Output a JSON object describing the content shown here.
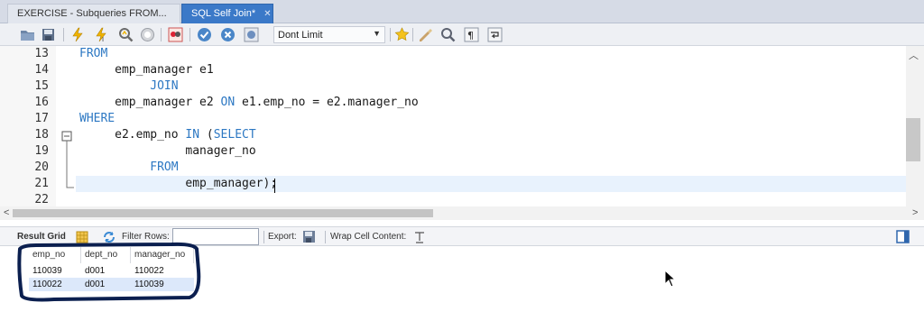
{
  "tabs": [
    {
      "label": "EXERCISE - Subqueries FROM...",
      "active": false
    },
    {
      "label": "SQL Self Join*",
      "active": true
    }
  ],
  "toolbar": {
    "limit_label": "Dont Limit",
    "icons": [
      "open-folder-icon",
      "save-icon",
      "execute-icon",
      "execute-selection-icon",
      "explain-icon",
      "stop-icon",
      "toggle-error-icon",
      "commit-icon",
      "rollback-icon",
      "autocommit-icon",
      "bookmark-icon",
      "beautify-icon",
      "find-icon",
      "invisible-chars-icon",
      "wrap-icon"
    ]
  },
  "editor": {
    "lines": [
      {
        "num": "13",
        "parts": [
          {
            "t": "FROM",
            "k": true
          }
        ]
      },
      {
        "num": "14",
        "parts": [
          {
            "t": "     emp_manager e1",
            "k": false
          }
        ]
      },
      {
        "num": "15",
        "parts": [
          {
            "t": "          ",
            "k": false
          },
          {
            "t": "JOIN",
            "k": true
          }
        ]
      },
      {
        "num": "16",
        "parts": [
          {
            "t": "     emp_manager e2 ",
            "k": false
          },
          {
            "t": "ON",
            "k": true
          },
          {
            "t": " e1.emp_no = e2.manager_no",
            "k": false
          }
        ]
      },
      {
        "num": "17",
        "parts": [
          {
            "t": "WHERE",
            "k": true
          }
        ]
      },
      {
        "num": "18",
        "parts": [
          {
            "t": "     e2.emp_no ",
            "k": false
          },
          {
            "t": "IN",
            "k": true
          },
          {
            "t": " (",
            "k": false
          },
          {
            "t": "SELECT",
            "k": true
          }
        ]
      },
      {
        "num": "19",
        "parts": [
          {
            "t": "               manager_no",
            "k": false
          }
        ]
      },
      {
        "num": "20",
        "parts": [
          {
            "t": "          ",
            "k": false
          },
          {
            "t": "FROM",
            "k": true
          }
        ]
      },
      {
        "num": "21",
        "parts": [
          {
            "t": "               emp_manager);",
            "k": false
          }
        ]
      },
      {
        "num": "22",
        "parts": []
      }
    ]
  },
  "result_bar": {
    "result_grid": "Result Grid",
    "filter_rows": "Filter Rows:",
    "filter_value": "",
    "export": "Export:",
    "wrap_cell": "Wrap Cell Content:"
  },
  "grid": {
    "columns": [
      "emp_no",
      "dept_no",
      "manager_no"
    ],
    "rows": [
      [
        "110039",
        "d001",
        "110022"
      ],
      [
        "110022",
        "d001",
        "110039"
      ]
    ]
  },
  "colors": {
    "keyword": "#2d78c3",
    "active_tab": "#3b79c8",
    "selected_row": "#dce8fa",
    "marker_ink": "#0b1f4f"
  }
}
